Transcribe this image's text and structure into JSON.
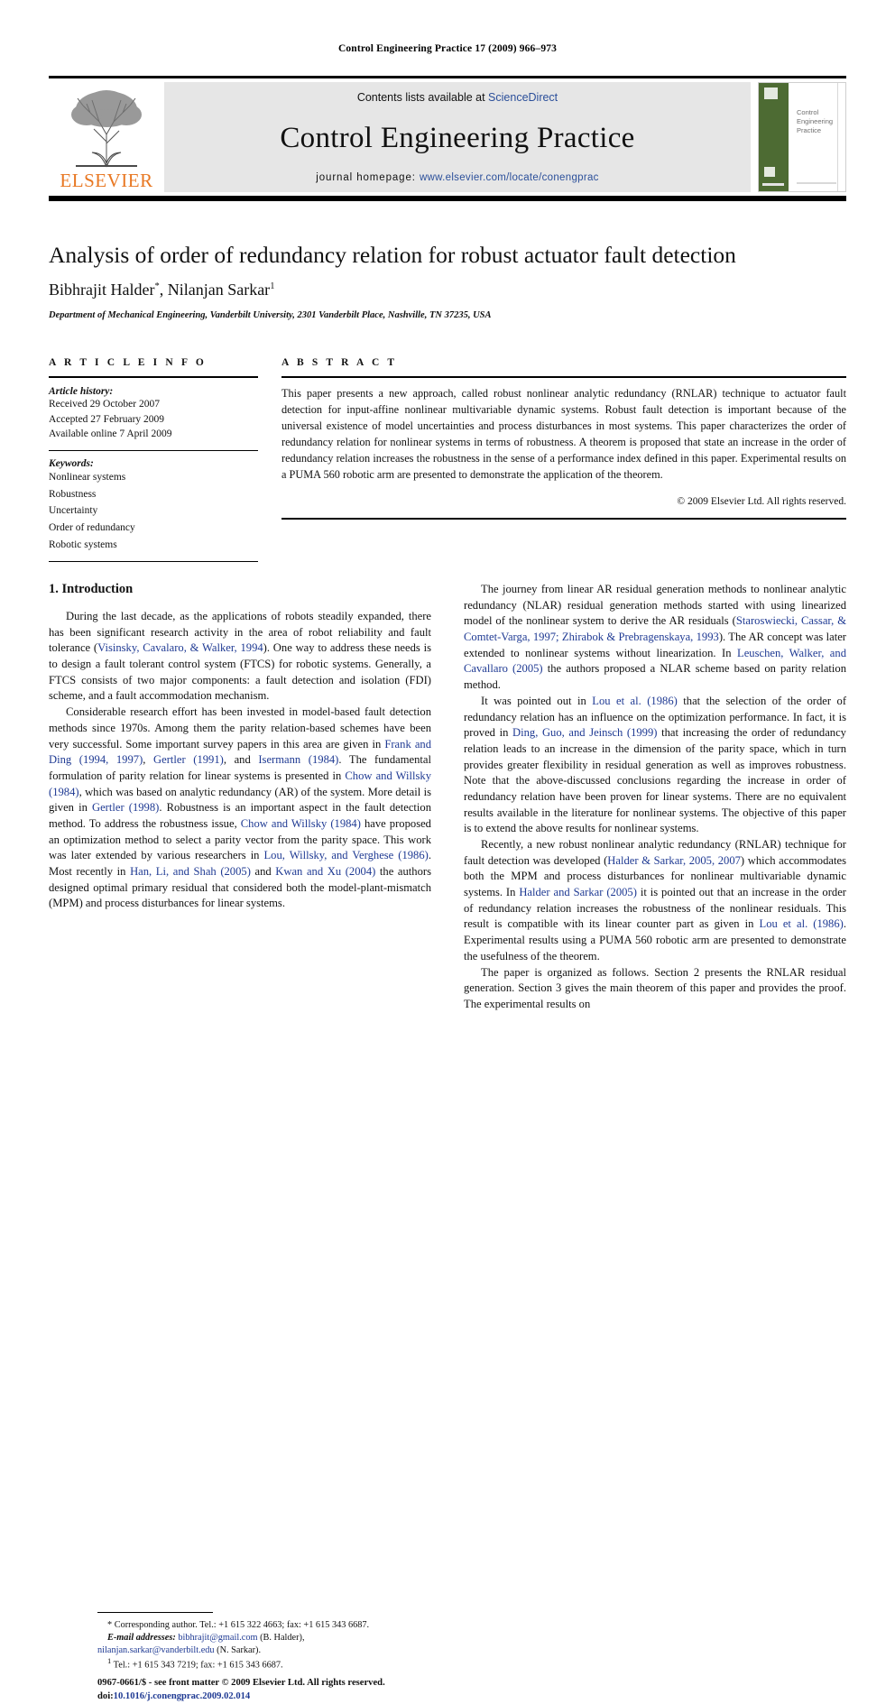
{
  "running_head": "Control Engineering Practice 17 (2009) 966–973",
  "masthead": {
    "contents_prefix": "Contents lists available at ",
    "contents_link": "ScienceDirect",
    "journal_name": "Control Engineering Practice",
    "homepage_prefix": "journal homepage: ",
    "homepage_link": "www.elsevier.com/locate/conengprac",
    "publisher_logo_text": "ELSEVIER",
    "cover_title_line1": "Control",
    "cover_title_line2": "Engineering",
    "cover_title_line3": "Practice",
    "link_color": "#2B4F9A",
    "elsevier_orange": "#E87722",
    "cover_green": "#4d6b33"
  },
  "article": {
    "title": "Analysis of order of redundancy relation for robust actuator fault detection",
    "author_1": "Bibhrajit Halder",
    "author_1_mark": "*",
    "author_separator": ", ",
    "author_2": "Nilanjan Sarkar",
    "author_2_mark": "1",
    "affiliation": "Department of Mechanical Engineering, Vanderbilt University, 2301 Vanderbilt Place, Nashville, TN 37235, USA"
  },
  "article_info": {
    "label": "A R T I C L E  I N F O",
    "history_heading": "Article history:",
    "history": [
      "Received 29 October 2007",
      "Accepted 27 February 2009",
      "Available online 7 April 2009"
    ],
    "keywords_heading": "Keywords:",
    "keywords": [
      "Nonlinear systems",
      "Robustness",
      "Uncertainty",
      "Order of redundancy",
      "Robotic systems"
    ]
  },
  "abstract": {
    "label": "A B S T R A C T",
    "text": "This paper presents a new approach, called robust nonlinear analytic redundancy (RNLAR) technique to actuator fault detection for input-affine nonlinear multivariable dynamic systems. Robust fault detection is important because of the universal existence of model uncertainties and process disturbances in most systems. This paper characterizes the order of redundancy relation for nonlinear systems in terms of robustness. A theorem is proposed that state an increase in the order of redundancy relation increases the robustness in the sense of a performance index defined in this paper. Experimental results on a PUMA 560 robotic arm are presented to demonstrate the application of the theorem.",
    "copyright": "© 2009 Elsevier Ltd. All rights reserved."
  },
  "introduction": {
    "heading": "1. Introduction",
    "p1_a": "During the last decade, as the applications of robots steadily expanded, there has been significant research activity in the area of robot reliability and fault tolerance (",
    "p1_ref1": "Visinsky, Cavalaro, & Walker, 1994",
    "p1_b": "). One way to address these needs is to design a fault tolerant control system (FTCS) for robotic systems. Generally, a FTCS consists of two major components: a fault detection and isolation (FDI) scheme, and a fault accommodation mechanism.",
    "p2_a": "Considerable research effort has been invested in model-based fault detection methods since 1970s. Among them the parity relation-based schemes have been very successful. Some important survey papers in this area are given in ",
    "p2_ref1": "Frank and Ding (1994, 1997)",
    "p2_b": ", ",
    "p2_ref2": "Gertler (1991)",
    "p2_c": ", and ",
    "p2_ref3": "Isermann (1984)",
    "p2_d": ". The fundamental formulation of parity relation for linear systems is presented in ",
    "p2_ref4": "Chow and Willsky (1984)",
    "p2_e": ", which was based on analytic redundancy (AR) of the system. More detail is given in ",
    "p2_ref5": "Gertler (1998)",
    "p2_f": ". Robustness is an important aspect in the fault detection method. To address the robustness issue, ",
    "p2_ref6": "Chow and Willsky (1984)",
    "p2_g": " have proposed an optimization method to select a parity vector from the parity space. This work was later extended by various researchers in ",
    "p2_ref7": "Lou, Willsky, and Verghese (1986)",
    "p2_h": ". Most recently in ",
    "p2_ref8": "Han, Li, and Shah (2005)",
    "p2_i": " and ",
    "p2_ref9": "Kwan and Xu (2004)",
    "p2_j": " the authors designed optimal primary residual that considered both the model-plant-mismatch (MPM) and process disturbances for linear systems.",
    "p3_a": "The journey from linear AR residual generation methods to nonlinear analytic redundancy (NLAR) residual generation methods started with using linearized model of the nonlinear system to derive the AR residuals (",
    "p3_ref1": "Staroswiecki, Cassar, & Comtet-Varga, 1997; Zhirabok & Prebragenskaya, 1993",
    "p3_b": "). The AR concept was later extended to nonlinear systems without linearization. In ",
    "p3_ref2": "Leuschen, Walker, and Cavallaro (2005)",
    "p3_c": " the authors proposed a NLAR scheme based on parity relation method.",
    "p4_a": "It was pointed out in ",
    "p4_ref1": "Lou et al. (1986)",
    "p4_b": " that the selection of the order of redundancy relation has an influence on the optimization performance. In fact, it is proved in ",
    "p4_ref2": "Ding, Guo, and Jeinsch (1999)",
    "p4_c": " that increasing the order of redundancy relation leads to an increase in the dimension of the parity space, which in turn provides greater flexibility in residual generation as well as improves robustness. Note that the above-discussed conclusions regarding the increase in order of redundancy relation have been proven for linear systems. There are no equivalent results available in the literature for nonlinear systems. The objective of this paper is to extend the above results for nonlinear systems.",
    "p5_a": "Recently, a new robust nonlinear analytic redundancy (RNLAR) technique for fault detection was developed (",
    "p5_ref1": "Halder & Sarkar, 2005, 2007",
    "p5_b": ") which accommodates both the MPM and process disturbances for nonlinear multivariable dynamic systems. In ",
    "p5_ref2": "Halder and Sarkar (2005)",
    "p5_c": " it is pointed out that an increase in the order of redundancy relation increases the robustness of the nonlinear residuals. This result is compatible with its linear counter part as given in ",
    "p5_ref3": "Lou et al. (1986)",
    "p5_d": ". Experimental results using a PUMA 560 robotic arm are presented to demonstrate the usefulness of the theorem.",
    "p6": "The paper is organized as follows. Section 2 presents the RNLAR residual generation. Section 3 gives the main theorem of this paper and provides the proof. The experimental results on"
  },
  "footnotes": {
    "corresponding_mark": "*",
    "corresponding": " Corresponding author. Tel.: +1 615 322 4663; fax: +1 615 343 6687.",
    "email_label": "E-mail addresses:",
    "email_1": "bibhrajit@gmail.com",
    "email_1_owner": " (B. Halder),",
    "email_2": "nilanjan.sarkar@vanderbilt.edu",
    "email_2_owner": " (N. Sarkar).",
    "fn1_mark": "1",
    "fn1": " Tel.: +1 615 343 7219; fax: +1 615 343 6687."
  },
  "issn": {
    "line1": "0967-0661/$ - see front matter © 2009 Elsevier Ltd. All rights reserved.",
    "doi_label": "doi:",
    "doi_value": "10.1016/j.conengprac.2009.02.014"
  }
}
